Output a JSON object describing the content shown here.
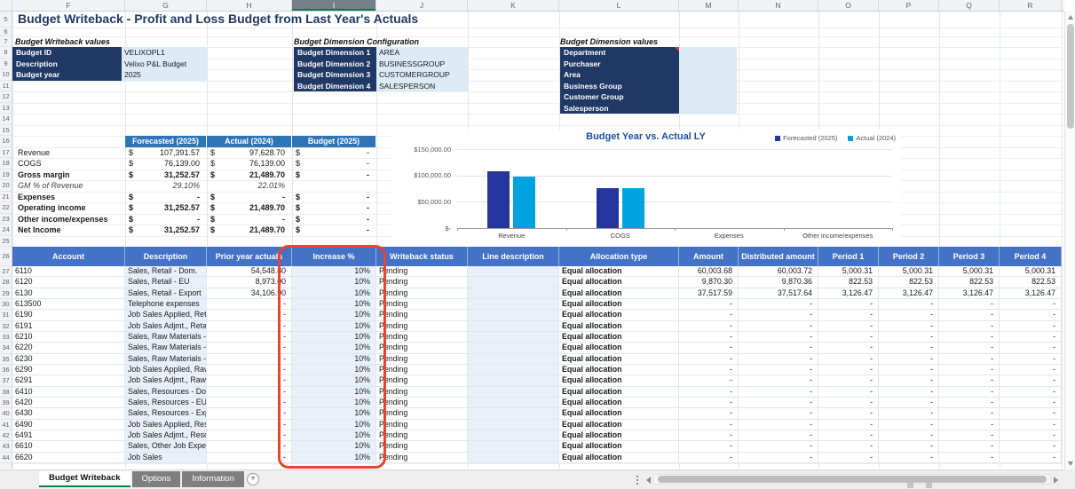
{
  "title": "Budget Writeback - Profit and Loss Budget from Last Year's Actuals",
  "columns": [
    "F",
    "G",
    "H",
    "I",
    "J",
    "K",
    "L",
    "M",
    "N",
    "O",
    "P",
    "Q",
    "R"
  ],
  "selected_column": "I",
  "row_numbers": [
    5,
    6,
    7,
    8,
    9,
    10,
    11,
    12,
    13,
    14,
    15,
    16,
    17,
    18,
    19,
    20,
    21,
    22,
    23,
    24,
    25,
    26,
    27,
    28,
    29,
    30,
    31,
    32,
    33,
    34,
    35,
    36,
    37,
    38,
    39,
    40,
    41,
    42,
    43,
    44
  ],
  "sections": {
    "writeback_values": {
      "title": "Budget Writeback values",
      "fields": [
        {
          "label": "Budget ID",
          "value": "VELIXOPL1"
        },
        {
          "label": "Description",
          "value": "Velixo P&L Budget"
        },
        {
          "label": "Budget year",
          "value": "2025"
        }
      ]
    },
    "dimension_config": {
      "title": "Budget Dimension Configuration",
      "fields": [
        {
          "label": "Budget Dimension 1",
          "value": "AREA"
        },
        {
          "label": "Budget Dimension 2",
          "value": "BUSINESSGROUP"
        },
        {
          "label": "Budget Dimension 3",
          "value": "CUSTOMERGROUP"
        },
        {
          "label": "Budget Dimension 4",
          "value": "SALESPERSON"
        }
      ]
    },
    "dimension_values": {
      "title": "Budget Dimension values",
      "items": [
        "Department",
        "Purchaser",
        "Area",
        "Business Group",
        "Customer Group",
        "Salesperson"
      ]
    }
  },
  "summary": {
    "headers": [
      "Forecasted (2025)",
      "Actual (2024)",
      "Budget (2025)"
    ],
    "rows": [
      {
        "label": "Revenue",
        "cls": "",
        "c1": [
          "$",
          "107,391.57"
        ],
        "c2": [
          "$",
          "97,628.70"
        ],
        "c3": [
          "$",
          "-"
        ]
      },
      {
        "label": "COGS",
        "cls": "",
        "c1": [
          "$",
          "76,139.00"
        ],
        "c2": [
          "$",
          "76,139.00"
        ],
        "c3": [
          "$",
          "-"
        ]
      },
      {
        "label": "Gross margin",
        "cls": "bold",
        "c1": [
          "$",
          "31,252.57"
        ],
        "c2": [
          "$",
          "21,489.70"
        ],
        "c3": [
          "$",
          "-"
        ]
      },
      {
        "label": "GM % of Revenue",
        "cls": "italic",
        "c1": [
          "",
          "29.10%"
        ],
        "c2": [
          "",
          "22.01%"
        ],
        "c3": [
          "",
          ""
        ]
      },
      {
        "label": "Expenses",
        "cls": "bold",
        "c1": [
          "$",
          "-"
        ],
        "c2": [
          "$",
          "-"
        ],
        "c3": [
          "$",
          "-"
        ]
      },
      {
        "label": "Operating income",
        "cls": "bold",
        "c1": [
          "$",
          "31,252.57"
        ],
        "c2": [
          "$",
          "21,489.70"
        ],
        "c3": [
          "$",
          "-"
        ]
      },
      {
        "label": "Other income/expenses",
        "cls": "bold",
        "c1": [
          "$",
          "-"
        ],
        "c2": [
          "$",
          "-"
        ],
        "c3": [
          "$",
          "-"
        ]
      },
      {
        "label": "Net Income",
        "cls": "bold",
        "c1": [
          "$",
          "31,252.57"
        ],
        "c2": [
          "$",
          "21,489.70"
        ],
        "c3": [
          "$",
          "-"
        ]
      }
    ]
  },
  "chart_data": {
    "type": "bar",
    "title": "Budget Year vs. Actual LY",
    "categories": [
      "Revenue",
      "COGS",
      "Expenses",
      "Other income/expenses"
    ],
    "series": [
      {
        "name": "Forecasted (2025)",
        "color": "#26359e",
        "values": [
          107391.57,
          76139.0,
          0,
          0
        ]
      },
      {
        "name": "Actual (2024)",
        "color": "#00a3e0",
        "values": [
          97628.7,
          76139.0,
          0,
          0
        ]
      }
    ],
    "y_ticks": [
      "$150,000.00",
      "$100,000.00",
      "$50,000.00",
      "$-"
    ],
    "ylim": [
      0,
      150000
    ],
    "legend_position": "top-right",
    "grid": true
  },
  "main_table": {
    "headers": [
      "Account",
      "Description",
      "Prior year actuals",
      "Increase %",
      "Writeback status",
      "Line description",
      "Allocation type",
      "Amount",
      "Distributed amount",
      "Period 1",
      "Period 2",
      "Period 3",
      "Period 4"
    ],
    "rows": [
      {
        "a": "6110",
        "d": "Sales, Retail - Dom.",
        "prior": "54,548.80",
        "inc": "10%",
        "status": "Pending",
        "line": "",
        "alloc": "Equal allocation",
        "amt": "60,003.68",
        "dist": "60,003.72",
        "p1": "5,000.31",
        "p2": "5,000.31",
        "p3": "5,000.31",
        "p4": "5,000.31"
      },
      {
        "a": "6120",
        "d": "Sales, Retail - EU",
        "prior": "8,973.00",
        "inc": "10%",
        "status": "Pending",
        "line": "",
        "alloc": "Equal allocation",
        "amt": "9,870.30",
        "dist": "9,870.36",
        "p1": "822.53",
        "p2": "822.53",
        "p3": "822.53",
        "p4": "822.53"
      },
      {
        "a": "6130",
        "d": "Sales, Retail - Export",
        "prior": "34,106.90",
        "inc": "10%",
        "status": "Pending",
        "line": "",
        "alloc": "Equal allocation",
        "amt": "37,517.59",
        "dist": "37,517.64",
        "p1": "3,126.47",
        "p2": "3,126.47",
        "p3": "3,126.47",
        "p4": "3,126.47"
      },
      {
        "a": "613500",
        "d": "Telephone expenses",
        "prior": "-",
        "inc": "10%",
        "status": "Pending",
        "line": "",
        "alloc": "Equal allocation",
        "amt": "-",
        "dist": "-",
        "p1": "-",
        "p2": "-",
        "p3": "-",
        "p4": "-"
      },
      {
        "a": "6190",
        "d": "Job Sales Applied, Retai",
        "prior": "-",
        "inc": "10%",
        "status": "Pending",
        "line": "",
        "alloc": "Equal allocation",
        "amt": "-",
        "dist": "-",
        "p1": "-",
        "p2": "-",
        "p3": "-",
        "p4": "-"
      },
      {
        "a": "6191",
        "d": "Job Sales Adjmt., Retail",
        "prior": "-",
        "inc": "10%",
        "status": "Pending",
        "line": "",
        "alloc": "Equal allocation",
        "amt": "-",
        "dist": "-",
        "p1": "-",
        "p2": "-",
        "p3": "-",
        "p4": "-"
      },
      {
        "a": "6210",
        "d": "Sales, Raw Materials - D",
        "prior": "-",
        "inc": "10%",
        "status": "Pending",
        "line": "",
        "alloc": "Equal allocation",
        "amt": "-",
        "dist": "-",
        "p1": "-",
        "p2": "-",
        "p3": "-",
        "p4": "-"
      },
      {
        "a": "6220",
        "d": "Sales, Raw Materials - E",
        "prior": "-",
        "inc": "10%",
        "status": "Pending",
        "line": "",
        "alloc": "Equal allocation",
        "amt": "-",
        "dist": "-",
        "p1": "-",
        "p2": "-",
        "p3": "-",
        "p4": "-"
      },
      {
        "a": "6230",
        "d": "Sales, Raw Materials - E",
        "prior": "-",
        "inc": "10%",
        "status": "Pending",
        "line": "",
        "alloc": "Equal allocation",
        "amt": "-",
        "dist": "-",
        "p1": "-",
        "p2": "-",
        "p3": "-",
        "p4": "-"
      },
      {
        "a": "6290",
        "d": "Job Sales Applied, Raw M",
        "prior": "-",
        "inc": "10%",
        "status": "Pending",
        "line": "",
        "alloc": "Equal allocation",
        "amt": "-",
        "dist": "-",
        "p1": "-",
        "p2": "-",
        "p3": "-",
        "p4": "-"
      },
      {
        "a": "6291",
        "d": "Job Sales Adjmt., Raw M",
        "prior": "-",
        "inc": "10%",
        "status": "Pending",
        "line": "",
        "alloc": "Equal allocation",
        "amt": "-",
        "dist": "-",
        "p1": "-",
        "p2": "-",
        "p3": "-",
        "p4": "-"
      },
      {
        "a": "6410",
        "d": "Sales, Resources - Dom",
        "prior": "-",
        "inc": "10%",
        "status": "Pending",
        "line": "",
        "alloc": "Equal allocation",
        "amt": "-",
        "dist": "-",
        "p1": "-",
        "p2": "-",
        "p3": "-",
        "p4": "-"
      },
      {
        "a": "6420",
        "d": "Sales, Resources - EU",
        "prior": "-",
        "inc": "10%",
        "status": "Pending",
        "line": "",
        "alloc": "Equal allocation",
        "amt": "-",
        "dist": "-",
        "p1": "-",
        "p2": "-",
        "p3": "-",
        "p4": "-"
      },
      {
        "a": "6430",
        "d": "Sales, Resources - Expo",
        "prior": "-",
        "inc": "10%",
        "status": "Pending",
        "line": "",
        "alloc": "Equal allocation",
        "amt": "-",
        "dist": "-",
        "p1": "-",
        "p2": "-",
        "p3": "-",
        "p4": "-"
      },
      {
        "a": "6490",
        "d": "Job Sales Applied, Reso",
        "prior": "-",
        "inc": "10%",
        "status": "Pending",
        "line": "",
        "alloc": "Equal allocation",
        "amt": "-",
        "dist": "-",
        "p1": "-",
        "p2": "-",
        "p3": "-",
        "p4": "-"
      },
      {
        "a": "6491",
        "d": "Job Sales Adjmt., Resou",
        "prior": "-",
        "inc": "10%",
        "status": "Pending",
        "line": "",
        "alloc": "Equal allocation",
        "amt": "-",
        "dist": "-",
        "p1": "-",
        "p2": "-",
        "p3": "-",
        "p4": "-"
      },
      {
        "a": "6610",
        "d": "Sales, Other Job Expens",
        "prior": "-",
        "inc": "10%",
        "status": "Pending",
        "line": "",
        "alloc": "Equal allocation",
        "amt": "-",
        "dist": "-",
        "p1": "-",
        "p2": "-",
        "p3": "-",
        "p4": "-"
      },
      {
        "a": "6620",
        "d": "Job Sales",
        "prior": "-",
        "inc": "10%",
        "status": "Pending",
        "line": "",
        "alloc": "Equal allocation",
        "amt": "-",
        "dist": "-",
        "p1": "-",
        "p2": "-",
        "p3": "-",
        "p4": "-"
      }
    ]
  },
  "tabs": [
    {
      "label": "Budget Writeback",
      "cls": "active"
    },
    {
      "label": "Options",
      "cls": ""
    },
    {
      "label": "Information",
      "cls": ""
    }
  ],
  "add_label": "+"
}
